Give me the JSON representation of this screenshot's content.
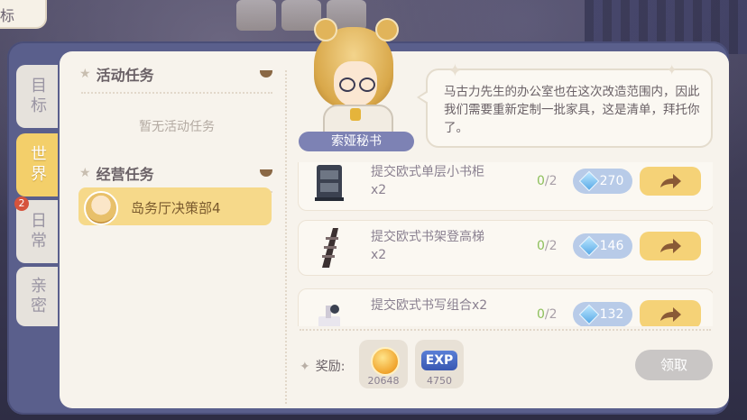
{
  "corner_tab": {
    "label": "标"
  },
  "side_tabs": [
    {
      "label": "目标",
      "active": false
    },
    {
      "label": "世界",
      "active": true
    },
    {
      "label": "日常",
      "active": false,
      "badge": "2"
    },
    {
      "label": "亲密",
      "active": false
    }
  ],
  "sections": {
    "activity": {
      "title": "活动任务",
      "empty_text": "暂无活动任务"
    },
    "business": {
      "title": "经营任务"
    }
  },
  "mission": {
    "name": "岛务厅决策部4"
  },
  "character": {
    "name": "索娅秘书"
  },
  "dialog": {
    "text": "马古力先生的办公室也在这次改造范围内，因此我们需要重新定制一批家具，这是清单，拜托你了。"
  },
  "tasks": [
    {
      "title": "提交欧式单层小书柜x2",
      "current": "0",
      "total": "/2",
      "reward": "270",
      "icon": "bookshelf-icon"
    },
    {
      "title": "提交欧式书架登高梯x2",
      "current": "0",
      "total": "/2",
      "reward": "146",
      "icon": "ladder-icon"
    },
    {
      "title": "提交欧式书写组合x2",
      "current": "0",
      "total": "/2",
      "reward": "132",
      "icon": "desk-set-icon"
    }
  ],
  "reward": {
    "label": "奖励:",
    "coin_amount": "20648",
    "exp_label": "EXP",
    "exp_amount": "4750"
  },
  "claim_button": "领取",
  "colors": {
    "frame": "#5a5f8c",
    "panel": "#f7f3ec",
    "active_tab": "#f3cf6a",
    "go_button": "#f5d277",
    "reward_pill": "#b8cbe8",
    "claim_disabled": "#c9c6c5"
  }
}
